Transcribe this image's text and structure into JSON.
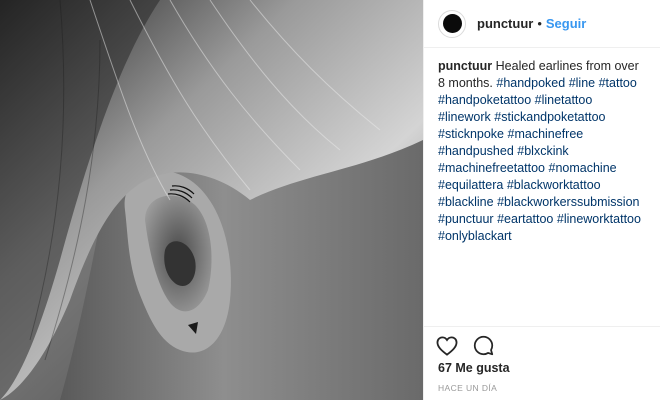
{
  "post": {
    "photo_alt": "Black and white photo of an ear with line tattoos",
    "author": {
      "username": "punctuur",
      "separator": "•",
      "follow_label": "Seguir"
    },
    "caption": {
      "username": "punctuur",
      "text": "Healed earlines from over 8 months.",
      "hashtags": [
        "#handpoked",
        "#line",
        "#tattoo",
        "#handpoketattoo",
        "#linetattoo",
        "#linework",
        "#stickandpoketattoo",
        "#sticknpoke",
        "#machinefree",
        "#handpushed",
        "#blxckink",
        "#machinefreetattoo",
        "#nomachine",
        "#equilattera",
        "#blackworktattoo",
        "#blackline",
        "#blackworkerssubmission",
        "#punctuur",
        "#eartattoo",
        "#lineworktattoo",
        "#onlyblackart"
      ]
    },
    "likes_label": "67 Me gusta",
    "timestamp": "HACE UN DÍA",
    "icons": {
      "like": "heart-icon",
      "comment": "comment-icon"
    },
    "colors": {
      "link": "#003569",
      "follow": "#3897f0",
      "text": "#262626",
      "muted": "#999999"
    }
  }
}
